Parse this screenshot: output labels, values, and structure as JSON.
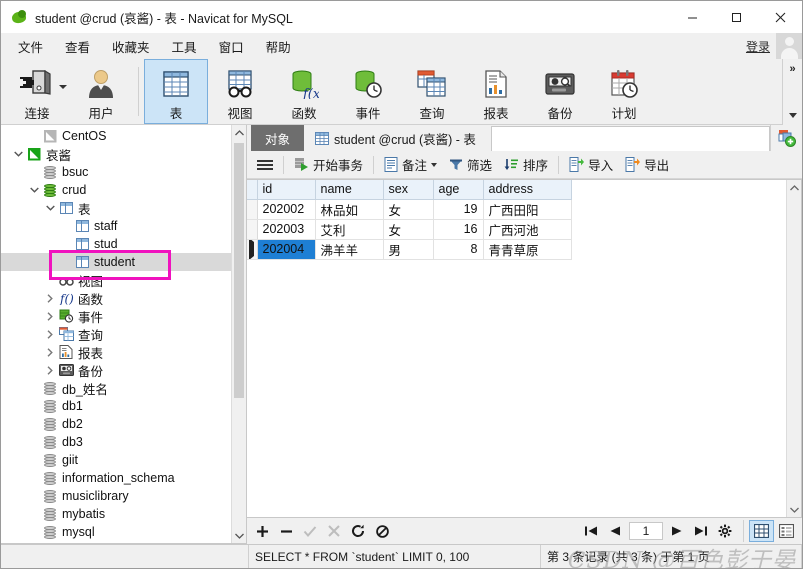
{
  "window": {
    "title": "student @crud (哀酱) - 表 - Navicat for MySQL",
    "app_icon": "navicat-logo-icon",
    "minimize_label": "─",
    "maximize_label": "☐",
    "close_label": "✕"
  },
  "menu": {
    "items": [
      {
        "label": "文件"
      },
      {
        "label": "查看"
      },
      {
        "label": "收藏夹"
      },
      {
        "label": "工具"
      },
      {
        "label": "窗口"
      },
      {
        "label": "帮助"
      }
    ],
    "login_label": "登录"
  },
  "toolbar": {
    "items": [
      {
        "label": "连接",
        "icon": "connection-icon",
        "selected": false,
        "has_caret": true
      },
      {
        "label": "用户",
        "icon": "user-icon",
        "selected": false,
        "has_caret": false
      },
      {
        "label": "表",
        "icon": "table-icon",
        "selected": true,
        "has_caret": false
      },
      {
        "label": "视图",
        "icon": "view-glasses-icon",
        "selected": false,
        "has_caret": false
      },
      {
        "label": "函数",
        "icon": "function-icon",
        "selected": false,
        "has_caret": false
      },
      {
        "label": "事件",
        "icon": "event-clock-icon",
        "selected": false,
        "has_caret": false
      },
      {
        "label": "查询",
        "icon": "query-icon",
        "selected": false,
        "has_caret": false
      },
      {
        "label": "报表",
        "icon": "report-icon",
        "selected": false,
        "has_caret": false
      },
      {
        "label": "备份",
        "icon": "backup-tape-icon",
        "selected": false,
        "has_caret": false
      },
      {
        "label": "计划",
        "icon": "schedule-calendar-icon",
        "selected": false,
        "has_caret": false
      }
    ],
    "overflow_label": "»"
  },
  "sidebar": {
    "tree": [
      {
        "label": "CentOS",
        "indent": 1,
        "twisty": "",
        "icon": "connection-grey-icon",
        "selected": false
      },
      {
        "label": "哀酱",
        "indent": 0,
        "twisty": "down",
        "icon": "connection-green-icon",
        "selected": false
      },
      {
        "label": "bsuc",
        "indent": 1,
        "twisty": "",
        "icon": "database-grey-icon",
        "selected": false
      },
      {
        "label": "crud",
        "indent": 1,
        "twisty": "down",
        "icon": "database-green-icon",
        "selected": false
      },
      {
        "label": "表",
        "indent": 2,
        "twisty": "down",
        "icon": "table-folder-icon",
        "selected": false
      },
      {
        "label": "staff",
        "indent": 3,
        "twisty": "",
        "icon": "table-icon",
        "selected": false
      },
      {
        "label": "stud",
        "indent": 3,
        "twisty": "",
        "icon": "table-icon",
        "selected": false
      },
      {
        "label": "student",
        "indent": 3,
        "twisty": "",
        "icon": "table-icon",
        "selected": true
      },
      {
        "label": "视图",
        "indent": 2,
        "twisty": "",
        "icon": "view-glasses-icon",
        "selected": false
      },
      {
        "label": "函数",
        "indent": 2,
        "twisty": "right",
        "icon": "function-icon",
        "selected": false
      },
      {
        "label": "事件",
        "indent": 2,
        "twisty": "right",
        "icon": "event-clock-icon",
        "selected": false
      },
      {
        "label": "查询",
        "indent": 2,
        "twisty": "right",
        "icon": "query-icon",
        "selected": false
      },
      {
        "label": "报表",
        "indent": 2,
        "twisty": "right",
        "icon": "report-icon",
        "selected": false
      },
      {
        "label": "备份",
        "indent": 2,
        "twisty": "right",
        "icon": "backup-tape-icon",
        "selected": false
      },
      {
        "label": "db_姓名",
        "indent": 1,
        "twisty": "",
        "icon": "database-grey-icon",
        "selected": false
      },
      {
        "label": "db1",
        "indent": 1,
        "twisty": "",
        "icon": "database-grey-icon",
        "selected": false
      },
      {
        "label": "db2",
        "indent": 1,
        "twisty": "",
        "icon": "database-grey-icon",
        "selected": false
      },
      {
        "label": "db3",
        "indent": 1,
        "twisty": "",
        "icon": "database-grey-icon",
        "selected": false
      },
      {
        "label": "giit",
        "indent": 1,
        "twisty": "",
        "icon": "database-grey-icon",
        "selected": false
      },
      {
        "label": "information_schema",
        "indent": 1,
        "twisty": "",
        "icon": "database-grey-icon",
        "selected": false
      },
      {
        "label": "musiclibrary",
        "indent": 1,
        "twisty": "",
        "icon": "database-grey-icon",
        "selected": false
      },
      {
        "label": "mybatis",
        "indent": 1,
        "twisty": "",
        "icon": "database-grey-icon",
        "selected": false
      },
      {
        "label": "mysql",
        "indent": 1,
        "twisty": "",
        "icon": "database-grey-icon",
        "selected": false
      }
    ]
  },
  "tabs": {
    "object_tab": "对象",
    "table_tab": "student @crud (哀酱) - 表"
  },
  "grid_toolbar": {
    "menu_icon": "hamburger-menu-icon",
    "items": [
      {
        "label": "开始事务",
        "icon": "begin-transaction-icon",
        "caret": false
      },
      {
        "label": "备注",
        "icon": "note-icon",
        "caret": true
      },
      {
        "label": "筛选",
        "icon": "filter-funnel-icon",
        "caret": false
      },
      {
        "label": "排序",
        "icon": "sort-icon",
        "caret": false
      },
      {
        "label": "导入",
        "icon": "import-icon",
        "caret": false
      },
      {
        "label": "导出",
        "icon": "export-icon",
        "caret": false
      }
    ]
  },
  "table": {
    "columns": [
      "id",
      "name",
      "sex",
      "age",
      "address"
    ],
    "rows": [
      {
        "cells": [
          "202002",
          "林品如",
          "女",
          "19",
          "广西田阳"
        ],
        "current": false
      },
      {
        "cells": [
          "202003",
          "艾利",
          "女",
          "16",
          "广西河池"
        ],
        "current": false
      },
      {
        "cells": [
          "202004",
          "沸羊羊",
          "男",
          "8",
          "青青草原"
        ],
        "current": true
      }
    ]
  },
  "grid_footer": {
    "add_icon": "plus-icon",
    "remove_icon": "minus-icon",
    "apply_icon": "check-icon",
    "cancel_icon": "cross-icon",
    "refresh_icon": "refresh-icon",
    "stop_icon": "stop-icon",
    "first_icon": "first-page-icon",
    "prev_icon": "prev-page-icon",
    "page_value": "1",
    "next_icon": "next-page-icon",
    "last_icon": "last-page-icon",
    "settings_icon": "gear-icon",
    "grid_view_icon": "grid-view-icon",
    "form_view_icon": "form-view-icon"
  },
  "status": {
    "sql": "SELECT * FROM `student` LIMIT 0, 100",
    "records": "第 3 条记录 (共 3 条) 于第 1 页",
    "watermark": "CSDN @百色彭于晏"
  },
  "colors": {
    "accent_selection": "#1e7fd4",
    "toolbar_selected": "#cce4f7",
    "annotation": "#f012be",
    "tab_active": "#6e6e6e",
    "header": "#eaf2fa"
  }
}
